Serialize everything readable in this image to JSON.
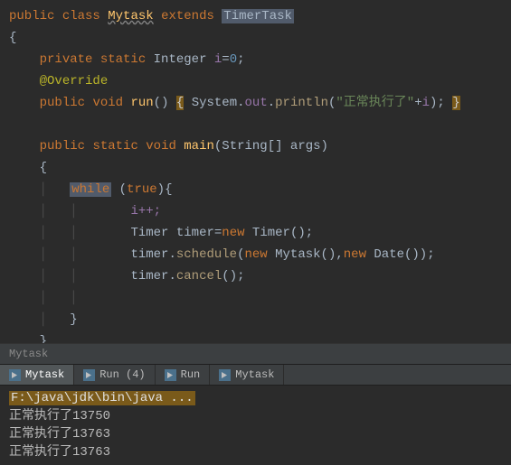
{
  "code": {
    "l1_public": "public",
    "l1_class": "class",
    "l1_name": "Mytask",
    "l1_extends": "extends",
    "l1_super": "TimerTask",
    "l3_private": "private",
    "l3_static": "static",
    "l3_type": "Integer",
    "l3_var": "i",
    "l3_eq": "=",
    "l3_val": "0",
    "l4_ann": "@Override",
    "l5_public": "public",
    "l5_void": "void",
    "l5_run": "run",
    "l5_sys": "System",
    "l5_out": "out",
    "l5_println": "println",
    "l5_str": "\"正常执行了\"",
    "l5_plus": "+",
    "l5_i": "i",
    "l7_public": "public",
    "l7_static": "static",
    "l7_void": "void",
    "l7_main": "main",
    "l7_stringarr": "String[]",
    "l7_args": "args",
    "l9_while": "while",
    "l9_true": "true",
    "l10_ipp": "i++;",
    "l11_timer1": "Timer",
    "l11_var": "timer",
    "l11_new": "new",
    "l11_timer2": "Timer",
    "l12_timer": "timer",
    "l12_schedule": "schedule",
    "l12_new1": "new",
    "l12_mytask": "Mytask",
    "l12_new2": "new",
    "l12_date": "Date",
    "l13_timer": "timer",
    "l13_cancel": "cancel"
  },
  "breadcrumb": "Mytask",
  "tabs": [
    {
      "label": "Mytask"
    },
    {
      "label": "Run (4)"
    },
    {
      "label": "Run"
    },
    {
      "label": "Mytask"
    }
  ],
  "console": {
    "cmd": "F:\\java\\jdk\\bin\\java ...",
    "lines": [
      "正常执行了13750",
      "正常执行了13763",
      "正常执行了13763"
    ]
  }
}
